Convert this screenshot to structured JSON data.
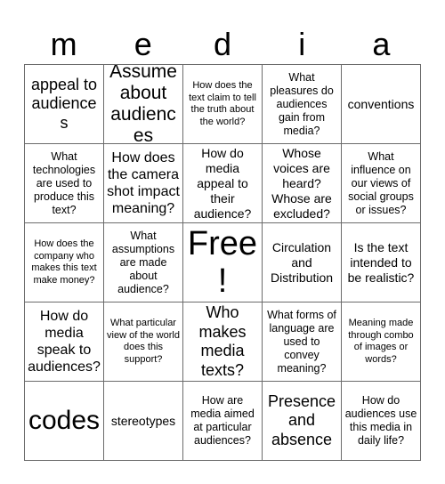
{
  "card": {
    "title_letters": [
      "m",
      "e",
      "d",
      "i",
      "a"
    ],
    "free_space_label": "Free!",
    "columns": 5,
    "rows": 5,
    "border_color": "#6b6b6b",
    "background_color": "#ffffff",
    "text_color": "#000000",
    "cells": [
      {
        "text": "appeal to audiences",
        "size": "sz-xl"
      },
      {
        "text": "Assume about audiences",
        "size": "sz-2xl"
      },
      {
        "text": "How does the text claim to tell the truth about the world?",
        "size": "sz-xs"
      },
      {
        "text": "What pleasures do audiences gain from media?",
        "size": "sz-sm"
      },
      {
        "text": "conventions",
        "size": "sz-md"
      },
      {
        "text": "What technologies are used to produce this text?",
        "size": "sz-sm"
      },
      {
        "text": "How does the camera shot impact meaning?",
        "size": "sz-lg"
      },
      {
        "text": "How do media appeal to their audience?",
        "size": "sz-md"
      },
      {
        "text": "Whose voices are heard? Whose are excluded?",
        "size": "sz-md"
      },
      {
        "text": "What influence on our views of social groups or issues?",
        "size": "sz-sm"
      },
      {
        "text": "How does the company who makes this text make money?",
        "size": "sz-xs"
      },
      {
        "text": "What assumptions are made about audience?",
        "size": "sz-sm"
      },
      {
        "text": "Free!",
        "size": "sz-free"
      },
      {
        "text": "Circulation and Distribution",
        "size": "sz-md"
      },
      {
        "text": "Is the text intended to be realistic?",
        "size": "sz-md"
      },
      {
        "text": "How do media speak to audiences?",
        "size": "sz-lg"
      },
      {
        "text": "What particular view of the world does this support?",
        "size": "sz-xs"
      },
      {
        "text": "Who makes media texts?",
        "size": "sz-xl"
      },
      {
        "text": "What forms of language are used to convey meaning?",
        "size": "sz-sm"
      },
      {
        "text": "Meaning made through combo of images or words?",
        "size": "sz-xs"
      },
      {
        "text": "codes",
        "size": "sz-3xl"
      },
      {
        "text": "stereotypes",
        "size": "sz-md"
      },
      {
        "text": "How are media aimed at particular audiences?",
        "size": "sz-sm"
      },
      {
        "text": "Presence and absence",
        "size": "sz-xl"
      },
      {
        "text": "How do audiences use this media in daily life?",
        "size": "sz-sm"
      }
    ]
  }
}
